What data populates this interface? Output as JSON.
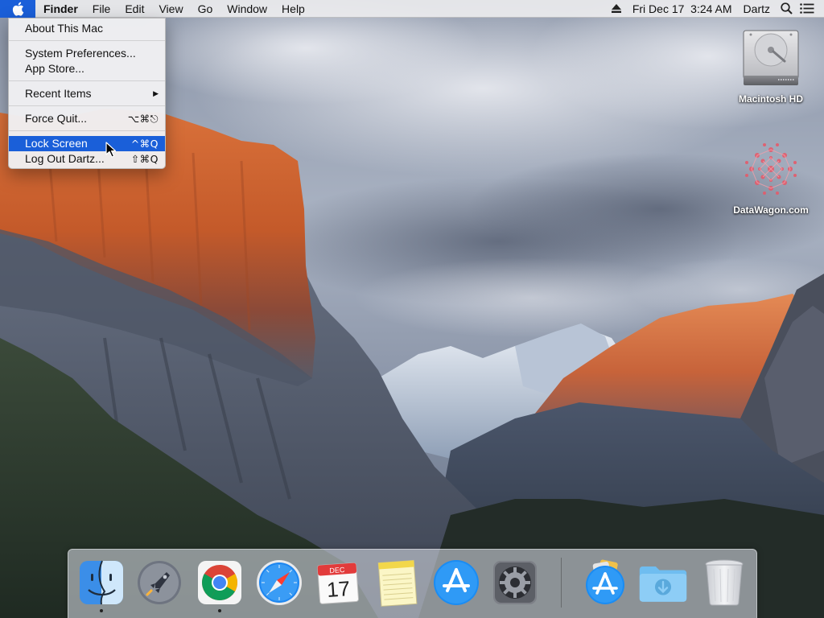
{
  "menubar": {
    "apple_icon": "apple-logo-icon",
    "app_name": "Finder",
    "menus": [
      "File",
      "Edit",
      "View",
      "Go",
      "Window",
      "Help"
    ],
    "datetime": "Fri Dec 17  3:24 AM",
    "user": "Dartz",
    "status_icons": [
      "eject-icon",
      "search-icon",
      "notification-center-icon"
    ]
  },
  "apple_menu": {
    "items": [
      {
        "label": "About This Mac",
        "shortcut": ""
      },
      {
        "label": "System Preferences...",
        "shortcut": ""
      },
      {
        "label": "App Store...",
        "shortcut": ""
      },
      {
        "label": "Recent Items",
        "shortcut": "",
        "submenu": true
      },
      {
        "label": "Force Quit...",
        "shortcut": "⌥⌘⎋"
      },
      {
        "label": "Lock Screen",
        "shortcut": "^⌘Q",
        "highlighted": true
      },
      {
        "label": "Log Out Dartz...",
        "shortcut": "⇧⌘Q"
      }
    ]
  },
  "desktop": {
    "icons": [
      {
        "label": "Macintosh HD",
        "icon": "hard-drive-icon"
      },
      {
        "label": "DataWagon.com",
        "icon": "datawagon-logo-icon"
      }
    ]
  },
  "dock": {
    "apps": [
      {
        "name": "Finder",
        "icon": "finder-icon",
        "running": true
      },
      {
        "name": "Launchpad",
        "icon": "launchpad-icon",
        "running": false
      },
      {
        "name": "Google Chrome",
        "icon": "chrome-icon",
        "running": true
      },
      {
        "name": "Safari",
        "icon": "safari-icon",
        "running": false
      },
      {
        "name": "Calendar",
        "icon": "calendar-icon",
        "running": false,
        "month": "DEC",
        "day": "17"
      },
      {
        "name": "Notes",
        "icon": "notes-icon",
        "running": false
      },
      {
        "name": "App Store",
        "icon": "app-store-icon",
        "running": false
      },
      {
        "name": "System Preferences",
        "icon": "system-preferences-icon",
        "running": false
      }
    ],
    "others": [
      {
        "name": "Applications",
        "icon": "applications-stack-icon"
      },
      {
        "name": "Downloads",
        "icon": "downloads-folder-icon"
      },
      {
        "name": "Trash",
        "icon": "trash-icon"
      }
    ]
  },
  "colors": {
    "highlight": "#1a5fd9",
    "menubar_bg": "#ececee"
  }
}
